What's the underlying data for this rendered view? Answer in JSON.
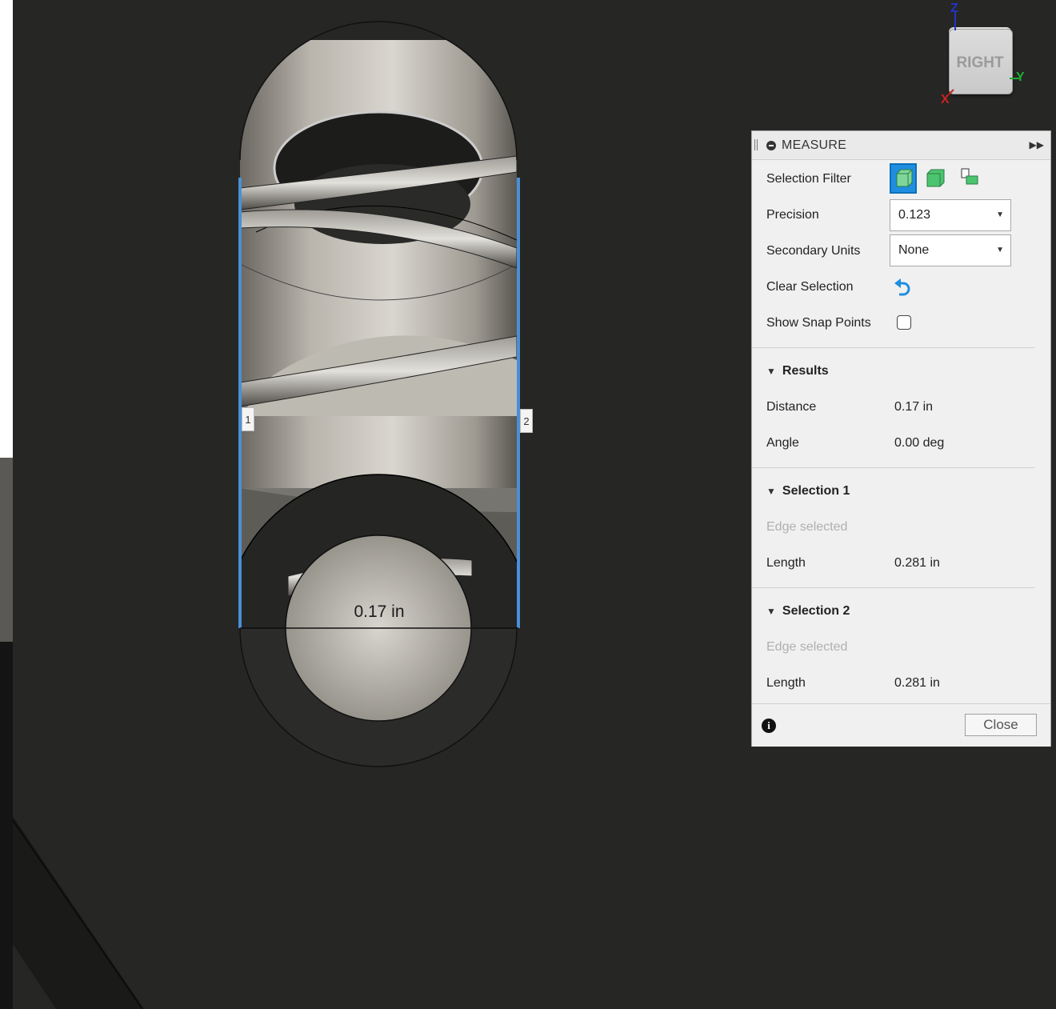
{
  "viewport": {
    "edge_tag_1": "1",
    "edge_tag_2": "2",
    "dimension_label": "0.17 in"
  },
  "view_cube": {
    "face_label": "RIGHT",
    "axis_z": "Z",
    "axis_y": "Y",
    "axis_x": "X",
    "colors": {
      "z": "#2233cc",
      "y": "#22aa33",
      "x": "#cc2222"
    }
  },
  "measure_panel": {
    "title": "MEASURE",
    "selection_filter_label": "Selection Filter",
    "selection_filter_icons": [
      "body-filter-icon",
      "face-filter-icon",
      "edge-filter-icon"
    ],
    "precision_label": "Precision",
    "precision_value": "0.123",
    "secondary_units_label": "Secondary Units",
    "secondary_units_value": "None",
    "clear_selection_label": "Clear Selection",
    "show_snap_points_label": "Show Snap Points",
    "show_snap_points_checked": false,
    "results": {
      "header": "Results",
      "distance_label": "Distance",
      "distance_value": "0.17 in",
      "angle_label": "Angle",
      "angle_value": "0.00 deg"
    },
    "selection1": {
      "header": "Selection 1",
      "status": "Edge selected",
      "length_label": "Length",
      "length_value": "0.281 in"
    },
    "selection2": {
      "header": "Selection 2",
      "status": "Edge selected",
      "length_label": "Length",
      "length_value": "0.281 in"
    },
    "close_label": "Close",
    "accent_color": "#1f8ee0"
  }
}
